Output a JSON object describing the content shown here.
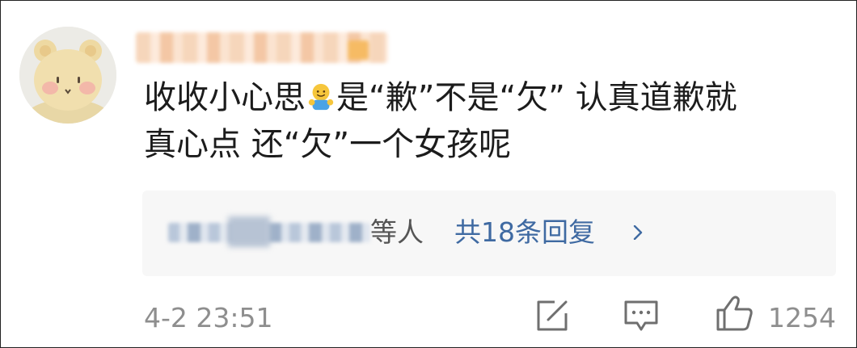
{
  "comment": {
    "avatar_icon": "bear-avatar-icon",
    "username_blurred": true,
    "text_line1_part1": "收收小心思",
    "emoji": "hugging-emoji-icon",
    "text_line1_part2": "是“歉”不是“欠” 认真道歉就",
    "text_line2": "真心点 还“欠”一个女孩呢",
    "timestamp": "4-2 23:51"
  },
  "replies": {
    "names_blurred": true,
    "suffix": "等人",
    "count_label": "共18条回复",
    "chevron_icon": "chevron-right-icon"
  },
  "actions": {
    "share_icon": "share-icon",
    "comment_icon": "comment-icon",
    "like_icon": "thumbs-up-icon",
    "like_count": "1254"
  },
  "colors": {
    "link_blue": "#3f6aa2",
    "meta_gray": "#8e8e8e",
    "reply_bg": "#f7f7f7"
  }
}
